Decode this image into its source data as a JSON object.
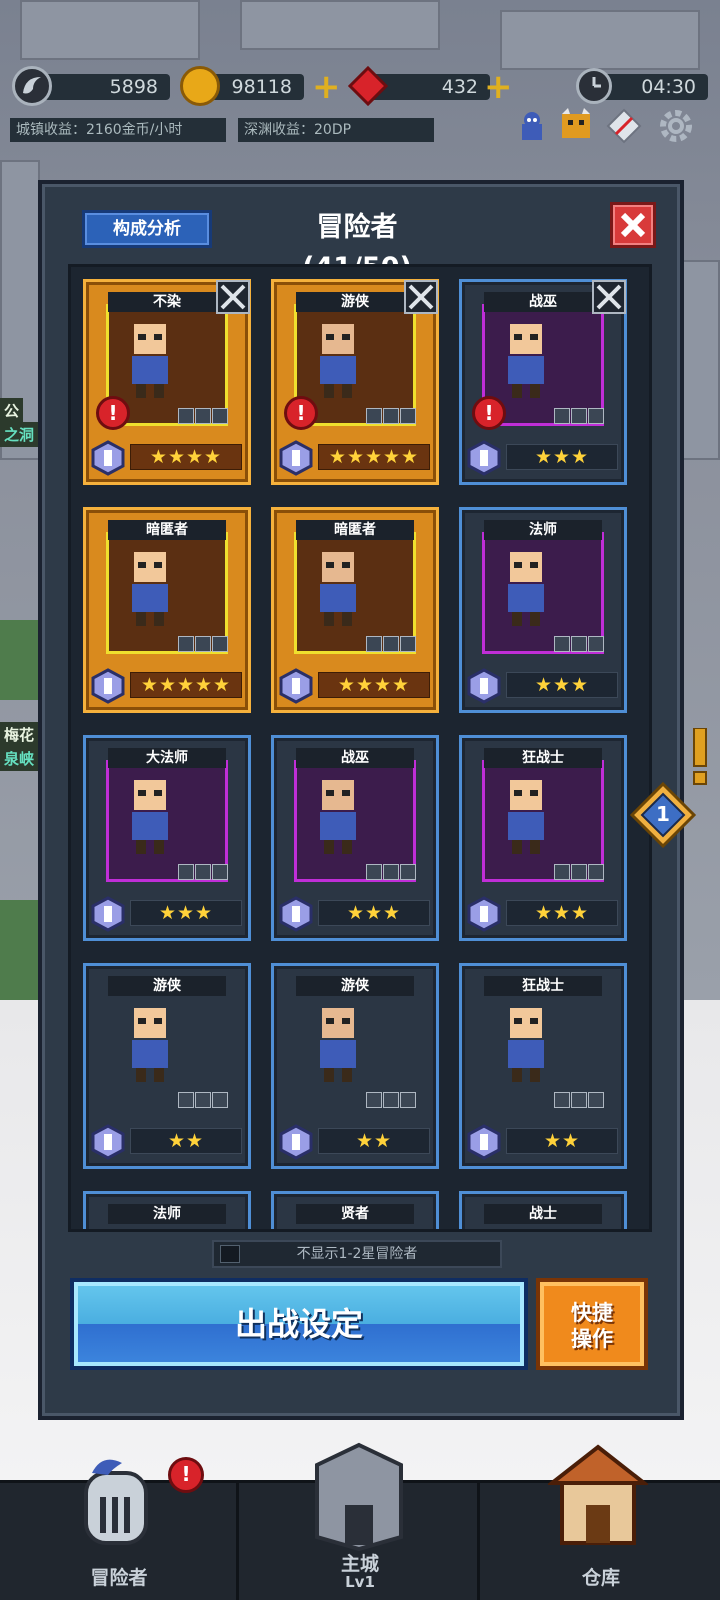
{
  "hud": {
    "soul": "5898",
    "gold": "98118",
    "gems": "432",
    "time": "04:30",
    "town_income": "城镇收益：2160金币/小时",
    "abyss_income": "深渊收益：20DP"
  },
  "background": {
    "sign_left_1": "公",
    "sign_left_2": "之洞",
    "sign_left_3": "梅花",
    "sign_left_4": "泉峡"
  },
  "panel": {
    "analysis_label": "构成分析",
    "title": "冒险者(41/50)",
    "hide_low_star_label": "不显示1-2星冒险者",
    "battle_setup_label": "出战设定",
    "quick_action_line1": "快捷",
    "quick_action_line2": "操作"
  },
  "adventurers": [
    {
      "name": "不染",
      "stars": "★★★★",
      "frame": "gold",
      "alert": true,
      "swords": true
    },
    {
      "name": "游侠",
      "stars": "★★★★★",
      "frame": "gold",
      "alert": true,
      "swords": true
    },
    {
      "name": "战巫",
      "stars": "★★★",
      "frame": "purple",
      "alert": true,
      "swords": true
    },
    {
      "name": "暗匿者",
      "stars": "★★★★★",
      "frame": "gold",
      "alert": false,
      "swords": false
    },
    {
      "name": "暗匿者",
      "stars": "★★★★",
      "frame": "gold",
      "alert": false,
      "swords": false
    },
    {
      "name": "法师",
      "stars": "★★★",
      "frame": "purple",
      "alert": false,
      "swords": false
    },
    {
      "name": "大法师",
      "stars": "★★★",
      "frame": "purple",
      "alert": false,
      "swords": false
    },
    {
      "name": "战巫",
      "stars": "★★★",
      "frame": "purple",
      "alert": false,
      "swords": false
    },
    {
      "name": "狂战士",
      "stars": "★★★",
      "frame": "purple",
      "alert": false,
      "swords": false
    },
    {
      "name": "游侠",
      "stars": "★★",
      "frame": "plain",
      "alert": false,
      "swords": false
    },
    {
      "name": "游侠",
      "stars": "★★",
      "frame": "plain",
      "alert": false,
      "swords": false
    },
    {
      "name": "狂战士",
      "stars": "★★",
      "frame": "plain",
      "alert": false,
      "swords": false
    },
    {
      "name": "法师",
      "stars": "",
      "frame": "plain",
      "alert": false,
      "swords": false
    },
    {
      "name": "贤者",
      "stars": "",
      "frame": "plain",
      "alert": false,
      "swords": false
    },
    {
      "name": "战士",
      "stars": "",
      "frame": "plain",
      "alert": false,
      "swords": false
    }
  ],
  "side_badge": {
    "count": "1"
  },
  "nav": {
    "adventurers": "冒险者",
    "adventurers_badge": "!",
    "castle": "主城",
    "castle_level": "Lv1",
    "warehouse": "仓库"
  },
  "colors": {
    "gold_frame": "#f5b13c",
    "purple_frame": "#c02ed8",
    "blue_frame": "#4f8fd6",
    "battle_button": "#3d86de",
    "quick_button": "#f08a1c",
    "close_button": "#d83a3a"
  }
}
